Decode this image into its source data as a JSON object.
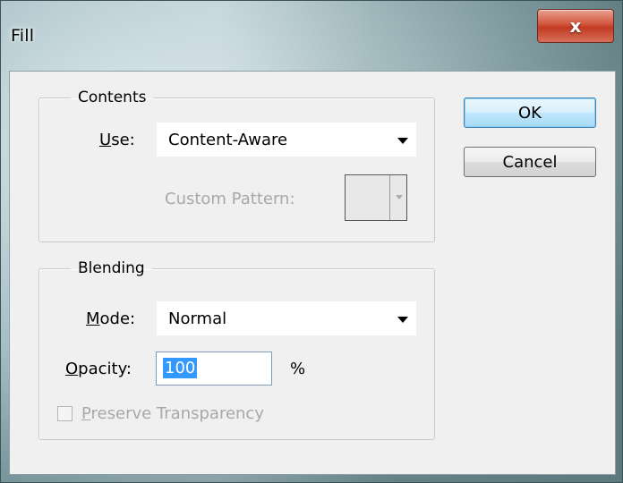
{
  "window": {
    "title": "Fill",
    "close_symbol": "x"
  },
  "contents": {
    "legend": "Contents",
    "use_label_mnemonic": "U",
    "use_label_rest": "se:",
    "use_value": "Content-Aware",
    "custom_pattern_label": "Custom Pattern:"
  },
  "blending": {
    "legend": "Blending",
    "mode_label_mnemonic": "M",
    "mode_label_rest": "ode:",
    "mode_value": "Normal",
    "opacity_label_mnemonic": "O",
    "opacity_label_rest": "pacity:",
    "opacity_value": "100",
    "opacity_unit": "%",
    "preserve_mnemonic": "P",
    "preserve_rest": "reserve Transparency",
    "preserve_checked": false
  },
  "buttons": {
    "ok": "OK",
    "cancel": "Cancel"
  },
  "icons": [
    "close-icon",
    "dropdown-arrow-icon",
    "checkbox-icon"
  ]
}
